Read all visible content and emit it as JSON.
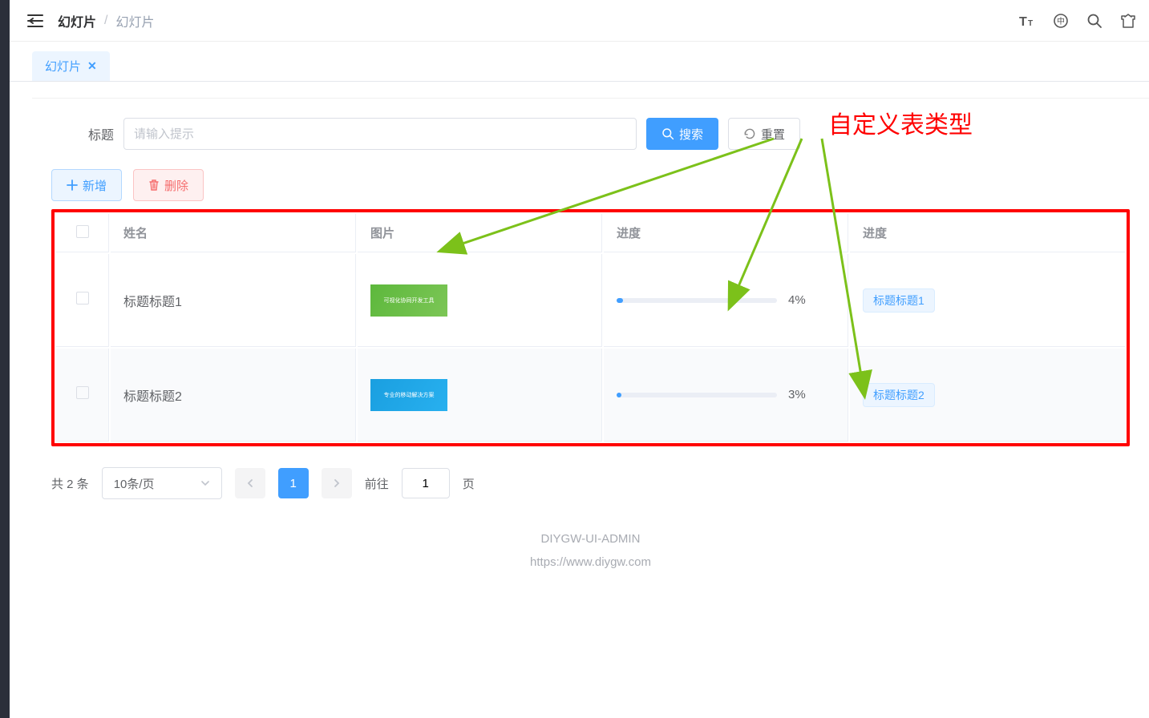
{
  "annotation": {
    "label": "自定义表类型"
  },
  "header": {
    "breadcrumb": [
      "幻灯片",
      "幻灯片"
    ],
    "separator": "/"
  },
  "tabs": [
    {
      "label": "幻灯片",
      "closable": true
    }
  ],
  "search": {
    "label": "标题",
    "placeholder": "请输入提示",
    "value": "",
    "searchBtn": "搜索",
    "resetBtn": "重置"
  },
  "actions": {
    "add": "新增",
    "delete": "删除"
  },
  "table": {
    "columns": [
      "姓名",
      "图片",
      "进度",
      "进度"
    ],
    "rows": [
      {
        "name": "标题标题1",
        "thumbColor": "green",
        "thumbText": "可视化协同开发工具",
        "progress": 4,
        "progressText": "4%",
        "tag": "标题标题1"
      },
      {
        "name": "标题标题2",
        "thumbColor": "blue",
        "thumbText": "专业的移动解决方案",
        "progress": 3,
        "progressText": "3%",
        "tag": "标题标题2"
      }
    ]
  },
  "pagination": {
    "total": "共 2 条",
    "pageSize": "10条/页",
    "currentPage": "1",
    "gotoLabel": "前往",
    "gotoSuffix": "页",
    "gotoValue": "1"
  },
  "footer": {
    "line1": "DIYGW-UI-ADMIN",
    "line2": "https://www.diygw.com"
  }
}
